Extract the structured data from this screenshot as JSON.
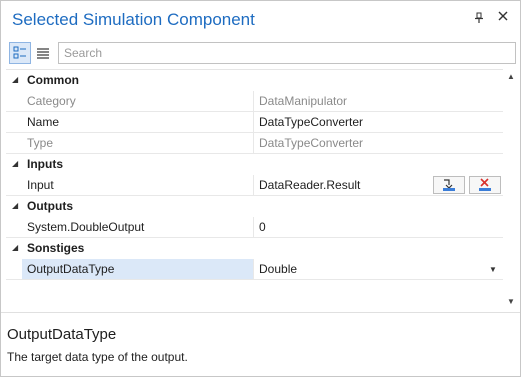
{
  "window": {
    "title": "Selected Simulation Component"
  },
  "titlebar_icons": {
    "pin": "pin-icon",
    "close": "close-icon"
  },
  "toolbar": {
    "categorized_icon": "categorized-view-icon",
    "alphabetical_icon": "alphabetical-view-icon",
    "search_placeholder": "Search"
  },
  "categories": [
    {
      "name": "Common",
      "properties": [
        {
          "name": "Category",
          "value": "DataManipulator",
          "readonly": true
        },
        {
          "name": "Name",
          "value": "DataTypeConverter",
          "readonly": false
        },
        {
          "name": "Type",
          "value": "DataTypeConverter",
          "readonly": true
        }
      ]
    },
    {
      "name": "Inputs",
      "properties": [
        {
          "name": "Input",
          "value": "DataReader.Result",
          "readonly": false,
          "buttons": [
            "connect-input-icon",
            "remove-connection-icon"
          ]
        }
      ]
    },
    {
      "name": "Outputs",
      "properties": [
        {
          "name": "System.DoubleOutput",
          "value": "0",
          "readonly": false
        }
      ]
    },
    {
      "name": "Sonstiges",
      "properties": [
        {
          "name": "OutputDataType",
          "value": "Double",
          "readonly": false,
          "selected": true,
          "dropdown": true
        }
      ]
    }
  ],
  "description": {
    "title": "OutputDataType",
    "text": "The target data type of the output."
  },
  "colors": {
    "title": "#1e6cc1",
    "selection": "#dbe8f8",
    "readonly_text": "#8a8a8a"
  }
}
